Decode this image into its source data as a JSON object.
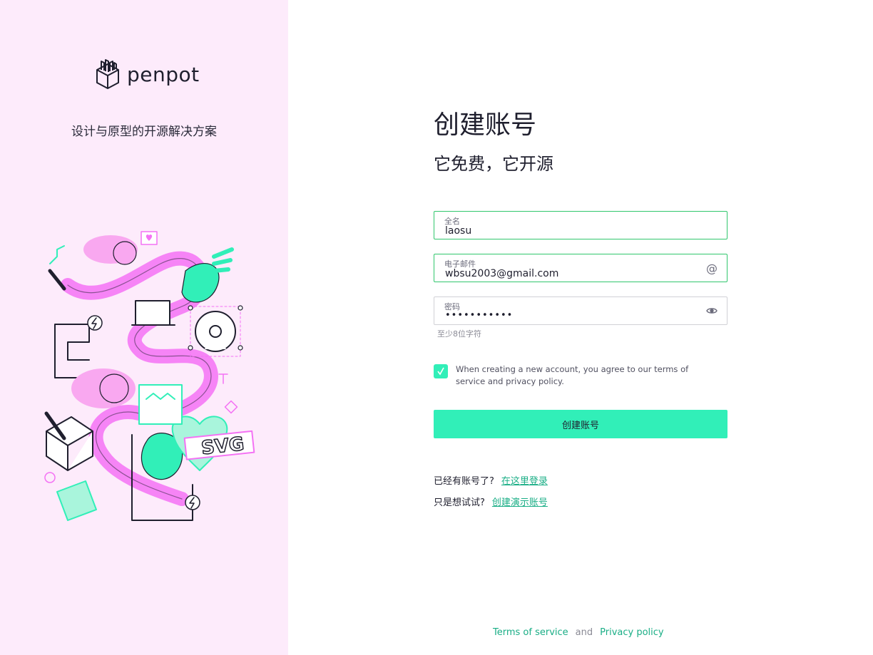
{
  "brand": {
    "name": "penpot",
    "tagline": "设计与原型的开源解决方案"
  },
  "form": {
    "title": "创建账号",
    "subtitle": "它免费，它开源",
    "fullname": {
      "label": "全名",
      "value": "laosu"
    },
    "email": {
      "label": "电子邮件",
      "value": "wbsu2003@gmail.com",
      "icon": "at-icon"
    },
    "password": {
      "label": "密码",
      "value": "•••••••••••",
      "icon": "eye-icon",
      "hint": "至少8位字符"
    },
    "terms": {
      "checked": true,
      "text": "When creating a new account, you agree to our terms of service and privacy policy."
    },
    "submit_label": "创建账号",
    "login_prompt": "已经有账号了?",
    "login_link": "在这里登录",
    "demo_prompt": "只是想试试?",
    "demo_link": "创建演示账号"
  },
  "footer": {
    "terms_link": "Terms of service",
    "and_text": "and",
    "privacy_link": "Privacy policy"
  },
  "colors": {
    "accent": "#31efb8",
    "panel": "#fdebfb",
    "valid_border": "#31c76d",
    "link": "#1aae86",
    "illustration_pink": "#f472f4",
    "illustration_mint": "#31efb8"
  }
}
